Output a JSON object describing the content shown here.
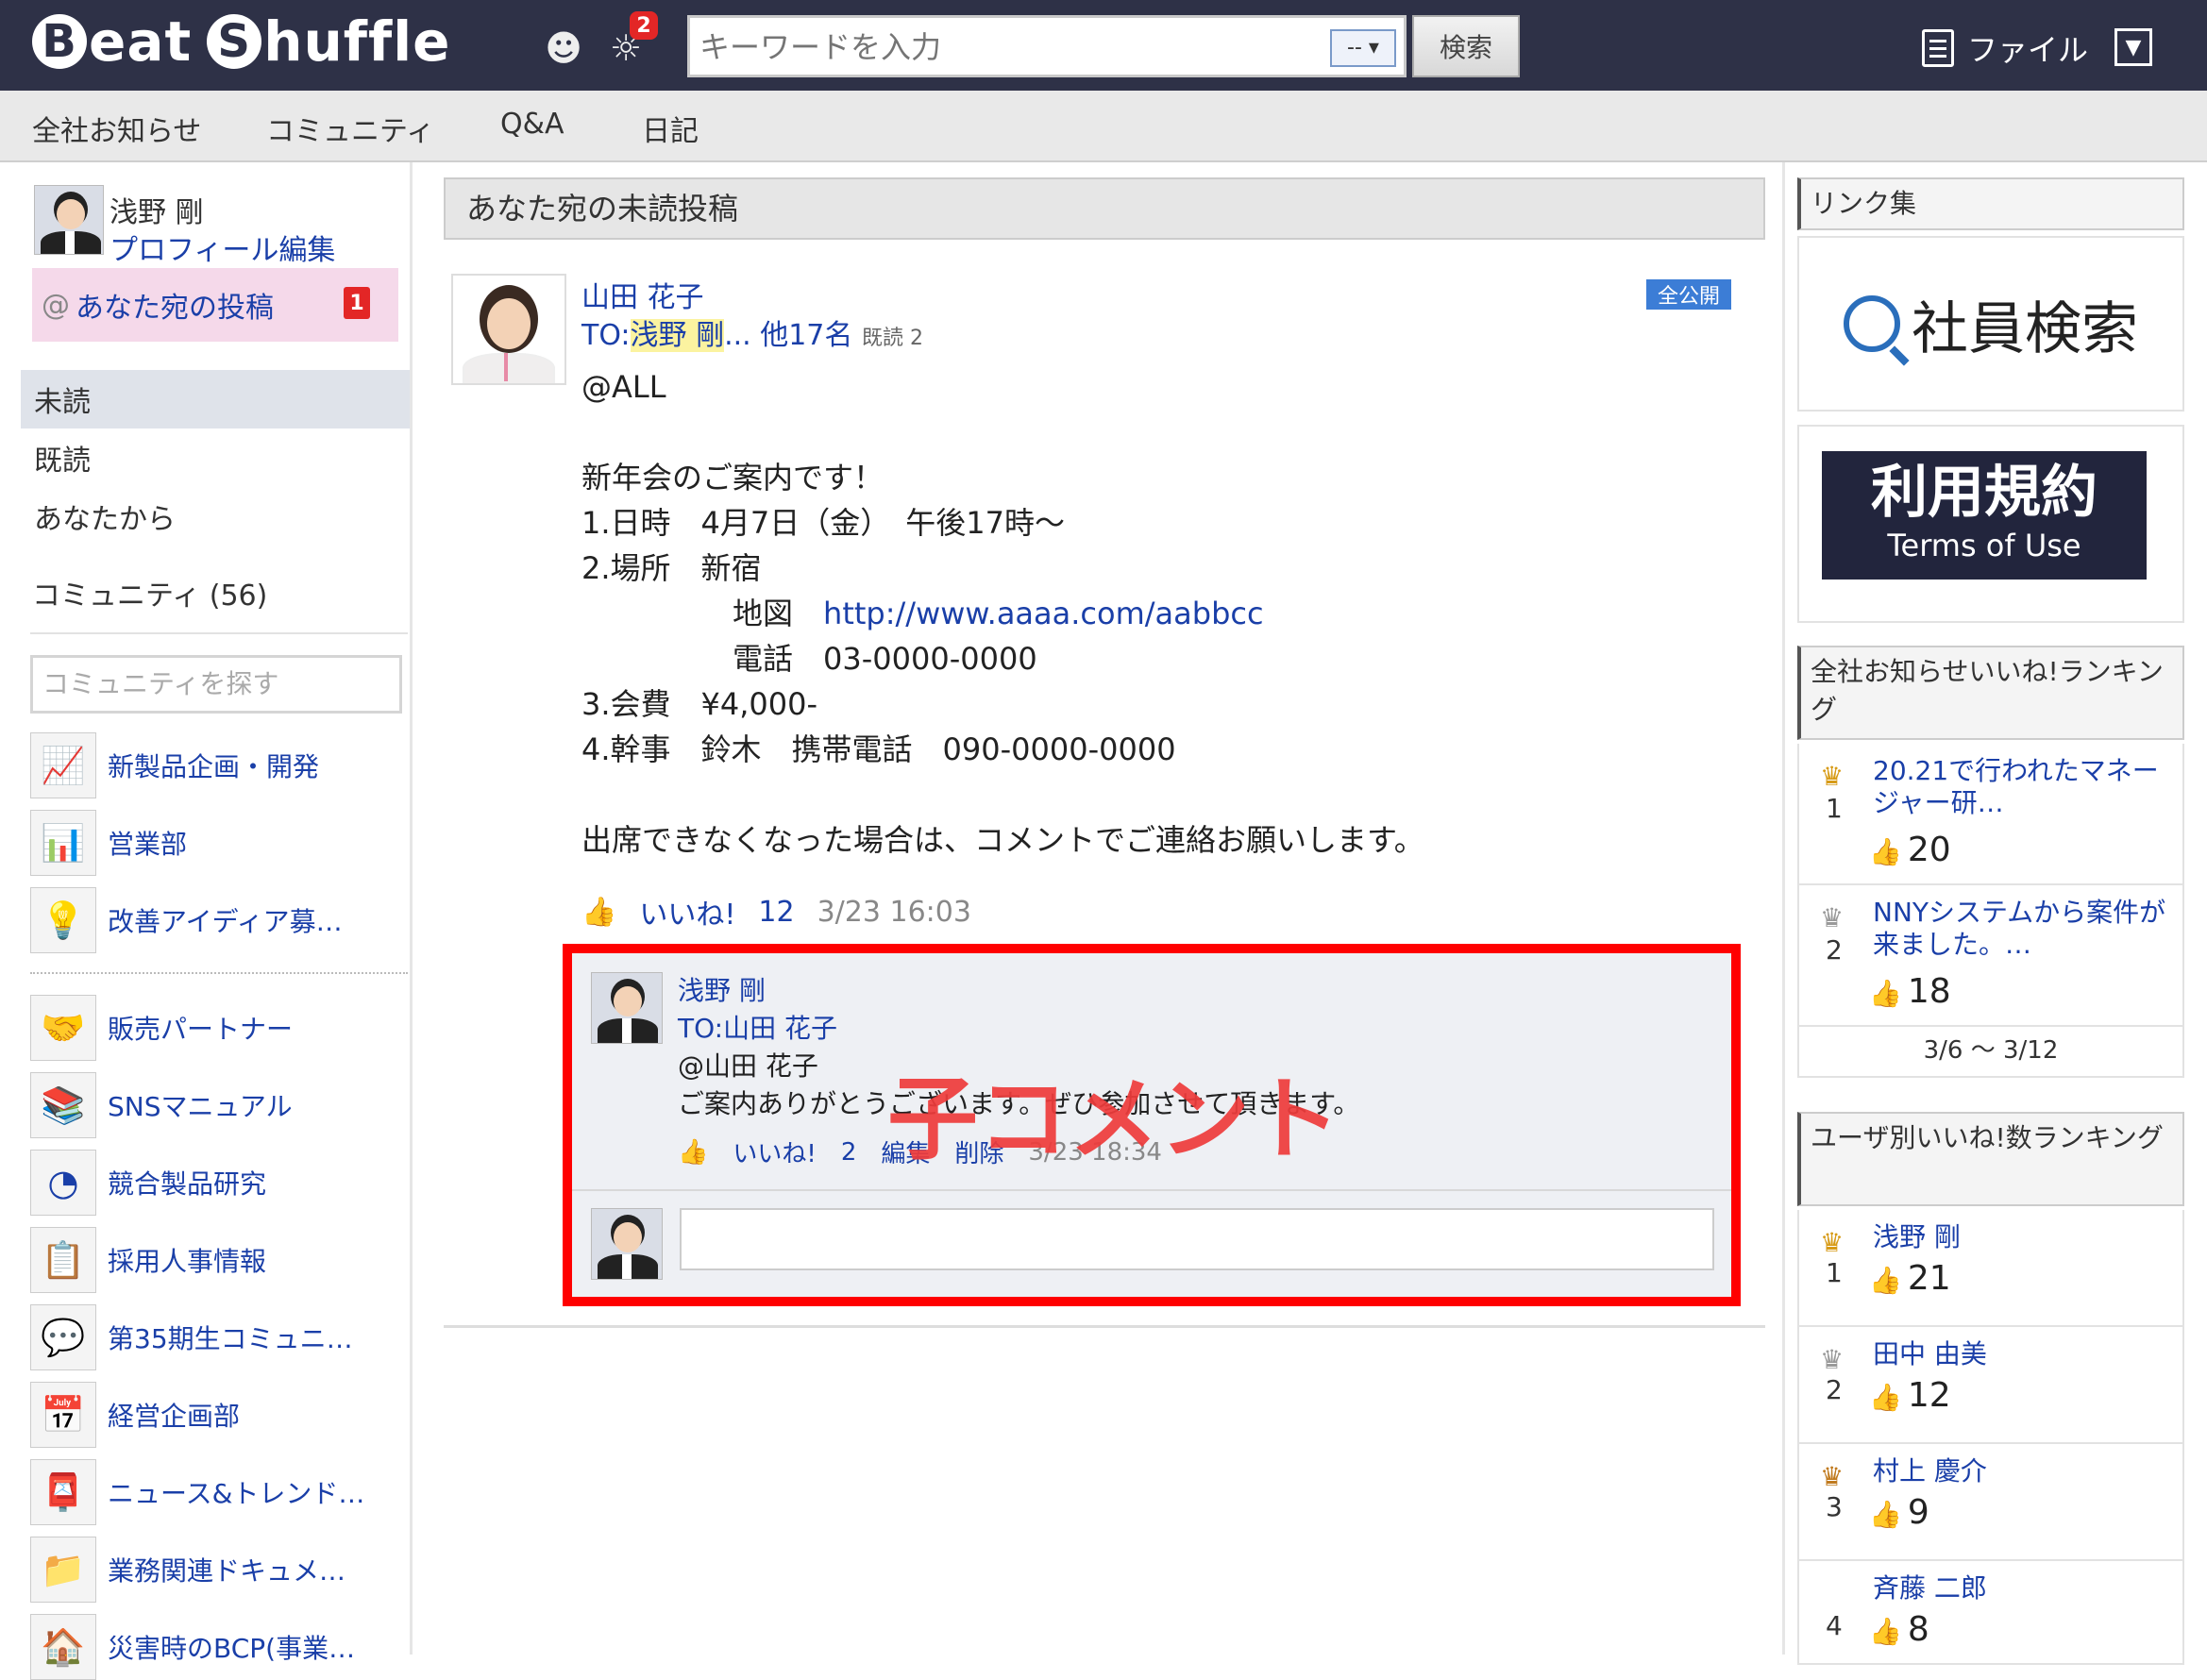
{
  "app": {
    "logo": "Beat Shuffle"
  },
  "header": {
    "notification_count": "2",
    "search_placeholder": "キーワードを入力",
    "search_select": "--",
    "search_button": "検索",
    "file_label": "ファイル"
  },
  "nav": {
    "items": [
      "全社お知らせ",
      "コミュニティ",
      "Q&A",
      "日記"
    ]
  },
  "sidebar": {
    "user_name": "浅野 剛",
    "profile_edit": "プロフィール編集",
    "mentions_label": "あなた宛の投稿",
    "mentions_count": "1",
    "filters": [
      "未読",
      "既読",
      "あなたから"
    ],
    "community_header": "コミュニティ (56)",
    "community_search_placeholder": "コミュニティを探す",
    "communities": [
      {
        "name": "新製品企画・開発",
        "icon": "chart-board-icon"
      },
      {
        "name": "営業部",
        "icon": "bar-chart-icon"
      },
      {
        "name": "改善アイディア募…",
        "icon": "lightbulb-icon"
      },
      {
        "name": "販売パートナー",
        "icon": "handshake-icon"
      },
      {
        "name": "SNSマニュアル",
        "icon": "books-icon"
      },
      {
        "name": "競合製品研究",
        "icon": "pie-chart-icon"
      },
      {
        "name": "採用人事情報",
        "icon": "clipboard-icon"
      },
      {
        "name": "第35期生コミュニ…",
        "icon": "chat-bubbles-icon"
      },
      {
        "name": "経営企画部",
        "icon": "calendar-icon"
      },
      {
        "name": "ニュース&トレンド…",
        "icon": "mailbox-icon"
      },
      {
        "name": "業務関連ドキュメ…",
        "icon": "folder-icon"
      },
      {
        "name": "災害時のBCP(事業…",
        "icon": "house-icon"
      }
    ]
  },
  "main": {
    "header": "あなた宛の未読投稿",
    "post": {
      "author": "山田 花子",
      "to_prefix": "TO:",
      "to_name": "浅野 剛",
      "to_rest": "... 他17名",
      "read_count": "既読 2",
      "visibility": "全公開",
      "body": {
        "line1": "@ALL",
        "line2": "新年会のご案内です！",
        "line3": "1.日時　4月7日（金）　午後17時〜",
        "line4": "2.場所　新宿",
        "map_label": "地図",
        "map_url": "http://www.aaaa.com/aabbcc",
        "tel_label": "電話",
        "tel": "03-0000-0000",
        "line7": "3.会費　¥4,000-",
        "line8": "4.幹事　鈴木　携帯電話　090-0000-0000",
        "line9": "出席できなくなった場合は、コメントでご連絡お願いします。"
      },
      "like_label": "いいね!",
      "like_count": "12",
      "timestamp": "3/23 16:03"
    },
    "comment": {
      "author": "浅野 剛",
      "to": "TO:山田 花子",
      "mention": "@山田 花子",
      "text": "ご案内ありがとうございます。ぜひ参加させて頂きます。",
      "like_label": "いいね!",
      "like_count": "2",
      "edit": "編集",
      "delete": "削除",
      "timestamp": "3/23 18:34"
    },
    "overlay_label": "子コメント"
  },
  "right": {
    "links_title": "リンク集",
    "employee_search": "社員検索",
    "terms_jp": "利用規約",
    "terms_en": "Terms of Use",
    "notice_ranking_title": "全社お知らせいいね!ランキング",
    "notice_ranking": [
      {
        "rank": "1",
        "title": "20.21で行われたマネージャー研…",
        "likes": "20"
      },
      {
        "rank": "2",
        "title": "NNYシステムから案件が来ました。…",
        "likes": "18"
      }
    ],
    "notice_range": "3/6 〜 3/12",
    "user_ranking_title": "ユーザ別いいね!数ランキング",
    "user_ranking": [
      {
        "rank": "1",
        "name": "浅野 剛",
        "likes": "21"
      },
      {
        "rank": "2",
        "name": "田中 由美",
        "likes": "12"
      },
      {
        "rank": "3",
        "name": "村上 慶介",
        "likes": "9"
      },
      {
        "rank": "4",
        "name": "斉藤 二郎",
        "likes": "8"
      }
    ]
  },
  "colors": {
    "header_bg": "#2e3147",
    "link": "#1a3fa8",
    "highlight_border": "#ff0000",
    "badge": "#e32626"
  }
}
